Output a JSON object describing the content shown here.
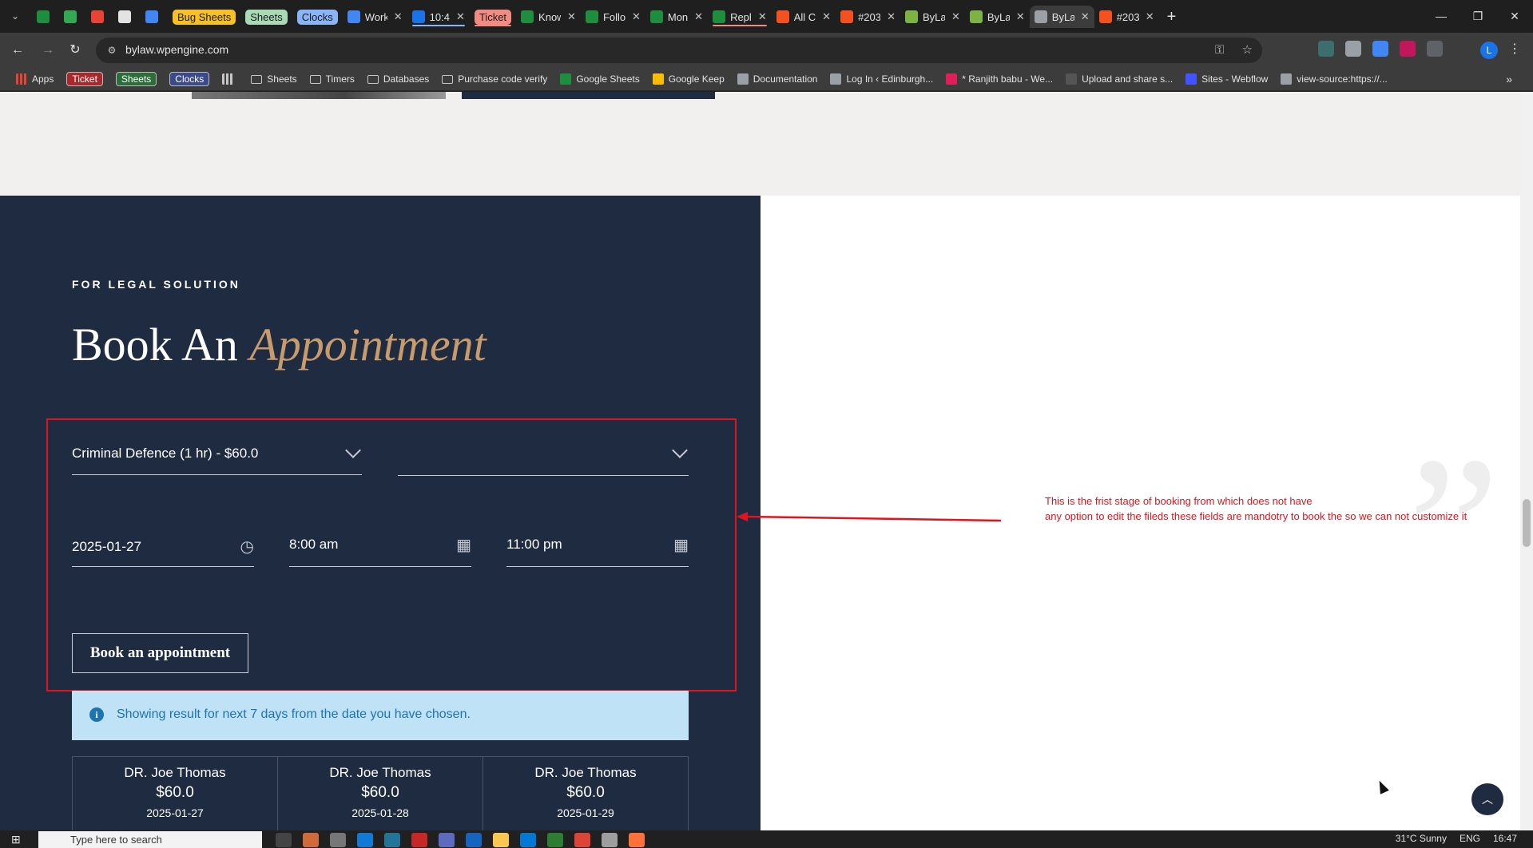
{
  "browser": {
    "tabs": [
      {
        "label": "",
        "type": "icon",
        "color": "#1e8e3e"
      },
      {
        "label": "",
        "type": "icon",
        "color": "#34a853"
      },
      {
        "label": "",
        "type": "icon",
        "color": "#ea4335"
      },
      {
        "label": "",
        "type": "icon",
        "color": "#e3e3e3"
      },
      {
        "label": "",
        "type": "icon",
        "color": "#4285f4"
      },
      {
        "label": "Bug Sheets",
        "type": "pill",
        "color": "#f6c026"
      },
      {
        "label": "Sheets",
        "type": "pill",
        "color": "#a8dab5"
      },
      {
        "label": "Clocks",
        "type": "pill",
        "color": "#8ab4f8"
      },
      {
        "label": "Work",
        "type": "tab",
        "color": "#4285f4",
        "underline": ""
      },
      {
        "label": "10:4",
        "type": "tab",
        "color": "#1a73e8",
        "underline": "#8ab4f8"
      },
      {
        "label": "Ticket",
        "type": "pill",
        "color": "#f28b82",
        "underline": "#f28b82"
      },
      {
        "label": "Know",
        "type": "tab",
        "color": "#1e8e3e",
        "underline": ""
      },
      {
        "label": "Follo",
        "type": "tab",
        "color": "#1e8e3e",
        "underline": ""
      },
      {
        "label": "Mon",
        "type": "tab",
        "color": "#1e8e3e",
        "underline": ""
      },
      {
        "label": "Repl",
        "type": "tab",
        "color": "#1e8e3e",
        "underline": "#f28b82"
      },
      {
        "label": "All C",
        "type": "tab",
        "color": "#f4511e",
        "underline": ""
      },
      {
        "label": "#203",
        "type": "tab",
        "color": "#f4511e",
        "underline": ""
      },
      {
        "label": "ByLa",
        "type": "tab",
        "color": "#7cb342",
        "underline": ""
      },
      {
        "label": "ByLa",
        "type": "tab",
        "color": "#7cb342",
        "underline": ""
      },
      {
        "label": "ByLa",
        "type": "tab-active",
        "color": "#9aa0a6",
        "underline": ""
      },
      {
        "label": "#203",
        "type": "tab",
        "color": "#f4511e",
        "underline": ""
      }
    ],
    "new_tab_symbol": "+",
    "url": "bylaw.wpengine.com",
    "profile_initial": "L"
  },
  "bookmarks": [
    {
      "label": "Apps",
      "kind": "grid",
      "color": "#ea4335"
    },
    {
      "label": "Ticket",
      "kind": "pill",
      "color": "#a8282c"
    },
    {
      "label": "Sheets",
      "kind": "pill",
      "color": "#2b6e3a"
    },
    {
      "label": "Clocks",
      "kind": "pill",
      "color": "#3b4a8c"
    },
    {
      "label": "",
      "kind": "grid",
      "color": "#c7c7c7"
    },
    {
      "label": "Sheets",
      "kind": "folder",
      "color": ""
    },
    {
      "label": "Timers",
      "kind": "folder",
      "color": ""
    },
    {
      "label": "Databases",
      "kind": "folder",
      "color": ""
    },
    {
      "label": "Purchase code verify",
      "kind": "folder",
      "color": ""
    },
    {
      "label": "Google Sheets",
      "kind": "icon",
      "color": "#1e8e3e"
    },
    {
      "label": "Google Keep",
      "kind": "icon",
      "color": "#fbbc04"
    },
    {
      "label": "Documentation",
      "kind": "icon",
      "color": "#9aa0a6"
    },
    {
      "label": "Log In ‹ Edinburgh...",
      "kind": "icon",
      "color": "#9aa0a6"
    },
    {
      "label": "* Ranjith babu - We...",
      "kind": "icon",
      "color": "#e01e5a"
    },
    {
      "label": "Upload and share s...",
      "kind": "icon",
      "color": "#555555"
    },
    {
      "label": "Sites - Webflow",
      "kind": "icon",
      "color": "#4353ff"
    },
    {
      "label": "view-source:https://...",
      "kind": "icon",
      "color": "#9aa0a6"
    }
  ],
  "page": {
    "eyebrow": "FOR LEGAL SOLUTION",
    "heading_plain": "Book An",
    "heading_accent": "Appointment",
    "service_select": "Criminal Defence (1 hr) - $60.0",
    "staff_select": "",
    "date_value": "2025-01-27",
    "start_time": "8:00 am",
    "end_time": "11:00 pm",
    "book_button": "Book an appointment",
    "info_text": "Showing result for next 7 days from the date you have chosen.",
    "results": [
      {
        "doctor": "DR. Joe Thomas",
        "price": "$60.0",
        "date": "2025-01-27"
      },
      {
        "doctor": "DR. Joe Thomas",
        "price": "$60.0",
        "date": "2025-01-28"
      },
      {
        "doctor": "DR. Joe Thomas",
        "price": "$60.0",
        "date": "2025-01-29"
      }
    ],
    "annotation_line1": "This is the frist stage of booking from which does not have",
    "annotation_line2": "any option to edit the fileds these fields are mandotry to book the so we can not customize it",
    "colors": {
      "panel": "#1f2b40",
      "accent": "#c89b6d",
      "annotation": "#e0141e",
      "info_bg": "#bfe2f7",
      "info_text": "#1d74b0"
    }
  },
  "taskbar": {
    "search_placeholder": "Type here to search",
    "weather": "31°C  Sunny",
    "language": "ENG",
    "time": "16:47"
  }
}
